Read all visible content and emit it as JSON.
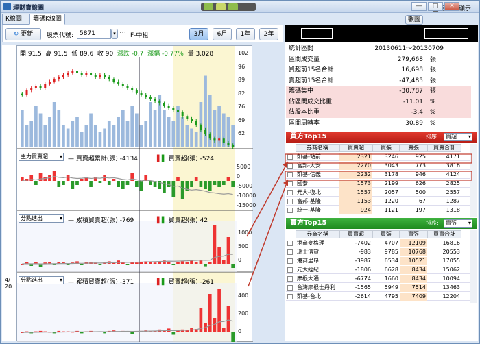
{
  "window": {
    "title": "理財寶線圖",
    "right_controls": "最上層顯示",
    "minimize": "—",
    "restore": "□",
    "close": "✕"
  },
  "tabs": [
    "K線圖",
    "籌碼K線圖"
  ],
  "toolbar": {
    "refresh": "更新",
    "code_label": "股票代號:",
    "code_value": "5871",
    "stock_name": "F-中租",
    "periods": [
      "3月",
      "6月",
      "1年",
      "2年"
    ],
    "selected_period": "3月"
  },
  "quote": {
    "open": "開 91.5",
    "high": "高 91.5",
    "low": "低 89.6",
    "close": "收 90",
    "change": "漲跌 -0.7",
    "change_pct": "漲幅 -0.77%",
    "volume": "量 3,028"
  },
  "price_axis": [
    "102",
    "96",
    "89",
    "82",
    "76",
    "69",
    "62"
  ],
  "panel2": {
    "selector": "主力買賣超",
    "cum": "買賣超累計(張) -4134",
    "net": "買賣超(張) -524",
    "axis": [
      "5000",
      "0",
      "-5000",
      "-10000",
      "-15000"
    ]
  },
  "panel3": {
    "selector": "分點進出",
    "cum": "累積買賣超(張) -769",
    "net": "買賣超(張) 42",
    "axis": [
      "1000",
      "500",
      "0"
    ]
  },
  "panel4": {
    "selector": "分點進出",
    "cum": "累積買賣超(張) -371",
    "net": "買賣超(張) -261",
    "axis": [
      "400",
      "200",
      "0"
    ]
  },
  "left_dates": [
    "4/",
    "20"
  ],
  "right": {
    "btn_small": "觀圖",
    "stats": [
      {
        "k": "統計區間",
        "v": "20130611～20130709",
        "u": "",
        "hl": false
      },
      {
        "k": "區間成交量",
        "v": "279,668",
        "u": "張",
        "hl": false
      },
      {
        "k": "買超前15名合計",
        "v": "16,698",
        "u": "張",
        "hl": false
      },
      {
        "k": "賣超前15名合計",
        "v": "-47,485",
        "u": "張",
        "hl": false
      },
      {
        "k": "籌碼集中",
        "v": "-30,787",
        "u": "張",
        "hl": true
      },
      {
        "k": "佔區間成交比重",
        "v": "-11.01",
        "u": "%",
        "hl": true
      },
      {
        "k": "佔股本比重",
        "v": "-3.4",
        "u": "%",
        "hl": true
      },
      {
        "k": "區間周轉率",
        "v": "30.89",
        "u": "%",
        "hl": false
      }
    ],
    "buy": {
      "title": "買方Top15",
      "sort_label": "排序:",
      "sort_value": "買超",
      "headers": [
        "券商名稱",
        "買賣超",
        "買張",
        "賣張",
        "買賣合計"
      ],
      "rows": [
        [
          "凱基-站前",
          "2321",
          "3246",
          "925",
          "4171"
        ],
        [
          "富邦-大安",
          "2270",
          "3043",
          "773",
          "3816"
        ],
        [
          "凱基-信義",
          "2232",
          "3178",
          "946",
          "4124"
        ],
        [
          "國泰",
          "1573",
          "2199",
          "626",
          "2825"
        ],
        [
          "元大-復北",
          "1557",
          "2057",
          "500",
          "2557"
        ],
        [
          "富邦-基隆",
          "1153",
          "1220",
          "67",
          "1287"
        ],
        [
          "統一-基隆",
          "924",
          "1121",
          "197",
          "1318"
        ]
      ]
    },
    "sell": {
      "title": "賣方Top15",
      "sort_label": "排序:",
      "sort_value": "賣張",
      "headers": [
        "券商名稱",
        "買賣超",
        "買張",
        "賣張",
        "買賣合計"
      ],
      "rows": [
        [
          "港商麥格理",
          "-7402",
          "4707",
          "12109",
          "16816"
        ],
        [
          "瑞士信貸",
          "-983",
          "9785",
          "10768",
          "20553"
        ],
        [
          "港商里昂",
          "-3987",
          "6534",
          "10521",
          "17055"
        ],
        [
          "元大經紀",
          "-1806",
          "6628",
          "8434",
          "15062"
        ],
        [
          "摩根大通",
          "-6774",
          "1660",
          "8434",
          "10094"
        ],
        [
          "台灣摩根士丹利",
          "-1565",
          "5949",
          "7514",
          "13463"
        ],
        [
          "凱基-台北",
          "-2614",
          "4795",
          "7409",
          "12204"
        ]
      ]
    }
  },
  "chart_data": {
    "type": "bar",
    "title": "",
    "xlabel": "",
    "ylabel": "",
    "ylim": [
      62,
      102
    ],
    "note_price_range": [
      62,
      102
    ],
    "price_closes": [
      86,
      88,
      89,
      90,
      89,
      91,
      92,
      93,
      94,
      95,
      96,
      97,
      96,
      95,
      96,
      95,
      94,
      95,
      94,
      93,
      92,
      91,
      90,
      89,
      88,
      87,
      86,
      85,
      84,
      83,
      82,
      81,
      80,
      79,
      78,
      76,
      75,
      74,
      72,
      70,
      68,
      66,
      65,
      66,
      64,
      63,
      62
    ],
    "volume_bars": [
      0.5,
      0.3,
      0.35,
      0.55,
      0.45,
      0.3,
      0.4,
      0.6,
      0.5,
      0.3,
      0.25,
      0.35,
      0.4,
      0.2,
      0.3,
      0.45,
      0.3,
      0.2,
      0.25,
      0.35,
      0.3,
      0.4,
      0.5,
      0.35,
      0.55,
      0.45,
      0.3,
      0.35,
      0.6,
      0.5,
      0.7,
      0.5,
      0.4,
      0.35,
      0.55,
      0.4,
      0.3,
      0.25,
      0.2,
      0.6,
      0.95,
      0.7,
      0.5,
      0.55,
      0.45,
      0.4,
      0.3
    ],
    "net_main": [
      0.2,
      0.1,
      0.3,
      -0.2,
      0.4,
      0.2,
      0.3,
      0.5,
      -0.3,
      -0.2,
      0.3,
      -0.4,
      -0.2,
      0.1,
      0.2,
      -0.3,
      0.2,
      -0.1,
      0.3,
      -0.2,
      0.1,
      -0.3,
      -0.4,
      -0.2,
      0.4,
      -0.3,
      -0.5,
      0.3,
      -0.2,
      -0.3,
      -0.4,
      -0.6,
      -0.3,
      -0.8,
      0.2,
      -0.9,
      -0.5,
      -0.3,
      0.2,
      -0.3,
      -0.4,
      -0.5,
      -0.2,
      -0.3,
      -0.2,
      0.2,
      -0.3
    ],
    "net_branch1": [
      0,
      0.05,
      -0.05,
      0.05,
      -0.08,
      0.03,
      0.05,
      -0.02,
      0.05,
      0.04,
      -0.03,
      0.03,
      0.06,
      -0.02,
      0.04,
      0.05,
      0.03,
      -0.02,
      0.04,
      0.06,
      0.03,
      0.08,
      0.04,
      -0.02,
      0.05,
      0.03,
      0.04,
      0.06,
      0.05,
      0.03,
      0.05,
      0.08,
      0.04,
      -0.03,
      0.05,
      0.06,
      0.04,
      0.1,
      0.05,
      0.08,
      -0.06,
      0.05,
      0.95,
      0.4,
      0.1,
      0.65,
      -0.1
    ],
    "net_branch2": [
      0,
      0.02,
      -0.02,
      0.02,
      0.03,
      0.02,
      0.01,
      -0.02,
      0.03,
      0.02,
      0.02,
      0.01,
      0.03,
      -0.02,
      0.02,
      0.03,
      0.02,
      0.02,
      -0.02,
      0.03,
      0.04,
      0.02,
      0.03,
      0.02,
      -0.03,
      0.02,
      0.03,
      0.04,
      0.02,
      0.03,
      0.06,
      0.05,
      0.08,
      -0.05,
      0.04,
      0.06,
      0.05,
      0.1,
      0.07,
      0.5,
      0.2,
      0.8,
      0.3,
      0.9,
      0.1,
      0.55,
      -0.4
    ]
  }
}
